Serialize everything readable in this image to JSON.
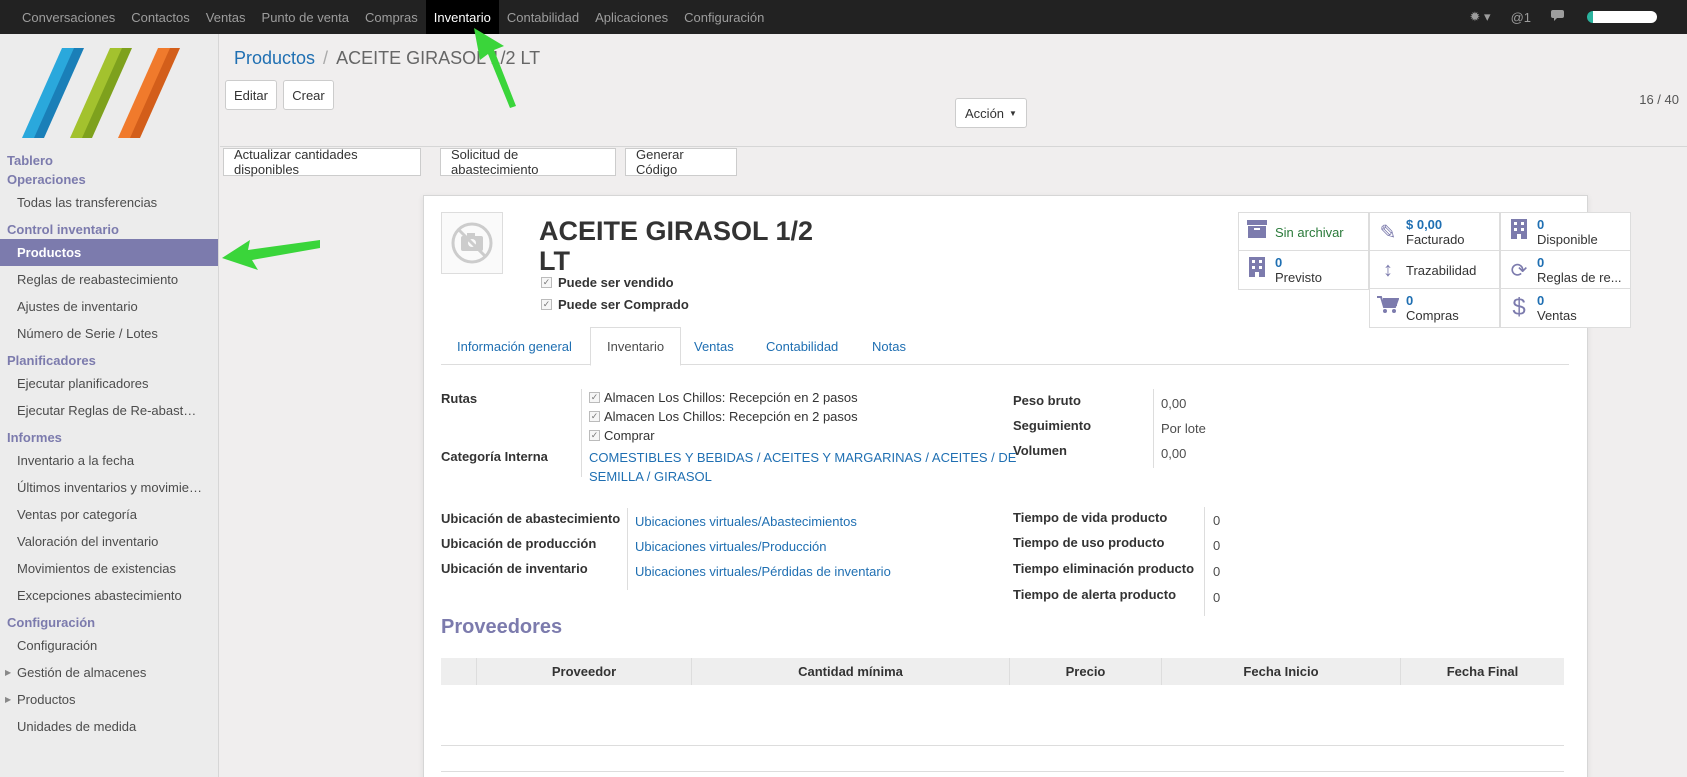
{
  "topbar": {
    "menu": [
      "Conversaciones",
      "Contactos",
      "Ventas",
      "Punto de venta",
      "Compras",
      "Inventario",
      "Contabilidad",
      "Aplicaciones",
      "Configuración"
    ],
    "active_index": 5,
    "bug_icon": "bug-icon",
    "at_label": "@1",
    "chat_icon": "chat-icon"
  },
  "sidebar": {
    "sections": [
      {
        "title": "Tablero",
        "items": []
      },
      {
        "title": "Operaciones",
        "items": [
          {
            "label": "Todas las transferencias"
          }
        ]
      },
      {
        "title": "Control inventario",
        "items": [
          {
            "label": "Productos",
            "active": true
          },
          {
            "label": "Reglas de reabastecimiento"
          },
          {
            "label": "Ajustes de inventario"
          },
          {
            "label": "Número de Serie / Lotes"
          }
        ]
      },
      {
        "title": "Planificadores",
        "items": [
          {
            "label": "Ejecutar planificadores"
          },
          {
            "label": "Ejecutar Reglas de Re-abastecimiento"
          }
        ]
      },
      {
        "title": "Informes",
        "items": [
          {
            "label": "Inventario a la fecha"
          },
          {
            "label": "Últimos inventarios y movimientos"
          },
          {
            "label": "Ventas por categoría"
          },
          {
            "label": "Valoración del inventario"
          },
          {
            "label": "Movimientos de existencias"
          },
          {
            "label": "Excepciones abastecimiento"
          }
        ]
      },
      {
        "title": "Configuración",
        "items": [
          {
            "label": "Configuración"
          },
          {
            "label": "Gestión de almacenes",
            "caret": true
          },
          {
            "label": "Productos",
            "caret": true
          },
          {
            "label": "Unidades de medida"
          }
        ]
      }
    ]
  },
  "breadcrumb": {
    "parent": "Productos",
    "sep": "/",
    "current": "ACEITE GIRASOL 1/2 LT"
  },
  "buttons": {
    "edit": "Editar",
    "create": "Crear",
    "action": "Acción",
    "pager": "16 / 40"
  },
  "header_buttons": [
    "Actualizar cantidades disponibles",
    "Solicitud de abastecimiento",
    "Generar Código"
  ],
  "product": {
    "name": "ACEITE GIRASOL 1/2 LT",
    "can_sell": "Puede ser vendido",
    "can_buy": "Puede ser Comprado"
  },
  "stats": {
    "archive": "Sin archivar",
    "invoiced_num": "$ 0,00",
    "invoiced_label": "Facturado",
    "available_num": "0",
    "available_label": "Disponible",
    "forecast_num": "0",
    "forecast_label": "Previsto",
    "traceability": "Trazabilidad",
    "rules_num": "0",
    "rules_label": "Reglas de re...",
    "purchases_num": "0",
    "purchases_label": "Compras",
    "sales_num": "0",
    "sales_label": "Ventas"
  },
  "tabs": [
    "Información general",
    "Inventario",
    "Ventas",
    "Contabilidad",
    "Notas"
  ],
  "inventory": {
    "routes_label": "Rutas",
    "routes": [
      "Almacen Los Chillos: Recepción en 2 pasos",
      "Almacen Los Chillos: Recepción en 2 pasos",
      "Comprar"
    ],
    "category_label": "Categoría Interna",
    "category_line1": "COMESTIBLES Y BEBIDAS / ACEITES Y MARGARINAS / ACEITES / DE",
    "category_line2": "SEMILLA / GIRASOL",
    "weight_label": "Peso bruto",
    "weight": "0,00",
    "tracking_label": "Seguimiento",
    "tracking": "Por lote",
    "volume_label": "Volumen",
    "volume": "0,00",
    "procurement_loc_label": "Ubicación de abastecimiento",
    "procurement_loc": "Ubicaciones virtuales/Abastecimientos",
    "production_loc_label": "Ubicación de producción",
    "production_loc": "Ubicaciones virtuales/Producción",
    "inventory_loc_label": "Ubicación de inventario",
    "inventory_loc": "Ubicaciones virtuales/Pérdidas de inventario",
    "life_label": "Tiempo de vida producto",
    "life": "0",
    "use_label": "Tiempo de uso producto",
    "use": "0",
    "removal_label": "Tiempo eliminación producto",
    "removal": "0",
    "alert_label": "Tiempo de alerta producto",
    "alert": "0"
  },
  "suppliers": {
    "title": "Proveedores",
    "columns": [
      "Proveedor",
      "Cantidad mínima",
      "Precio",
      "Fecha Inicio",
      "Fecha Final"
    ]
  },
  "colors": {
    "accent": "#7c7bad",
    "link": "#1f6fb2",
    "arrow": "#3ad53a"
  }
}
